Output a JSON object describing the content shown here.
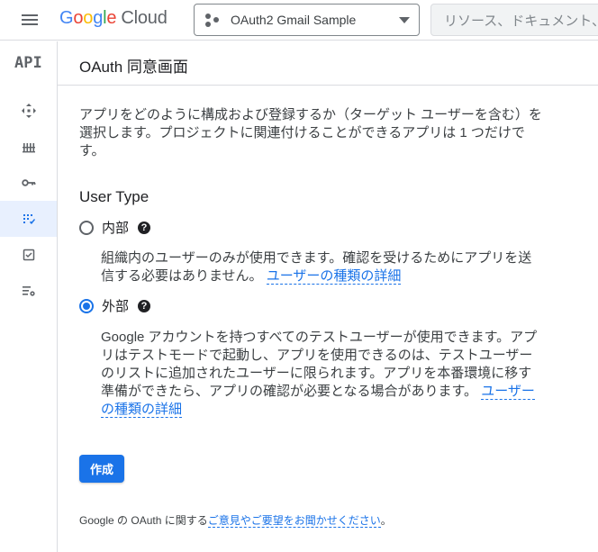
{
  "header": {
    "menu_icon": "hamburger-menu-icon",
    "logo": {
      "G": "G",
      "o1": "o",
      "o2": "o",
      "g": "g",
      "l": "l",
      "e": "e",
      "cloud": "Cloud"
    },
    "project_name": "OAuth2 Gmail Sample",
    "search_placeholder": "リソース、ドキュメント、"
  },
  "sidebar": {
    "api_label": "API",
    "items": [
      {
        "icon": "dashboard-icon",
        "active": false
      },
      {
        "icon": "library-icon",
        "active": false
      },
      {
        "icon": "key-icon",
        "active": false
      },
      {
        "icon": "consent-screen-icon",
        "active": true
      },
      {
        "icon": "checkbox-icon",
        "active": false
      },
      {
        "icon": "settings-list-icon",
        "active": false
      }
    ]
  },
  "main": {
    "title": "OAuth 同意画面",
    "intro": "アプリをどのように構成および登録するか（ターゲット ユーザーを含む）を選択します。プロジェクトに関連付けることができるアプリは 1 つだけです。",
    "user_type_title": "User Type",
    "internal": {
      "label": "内部",
      "checked": false,
      "desc": "組織内のユーザーのみが使用できます。確認を受けるためにアプリを送信する必要はありません。",
      "link": "ユーザーの種類の詳細"
    },
    "external": {
      "label": "外部",
      "checked": true,
      "desc": "Google アカウントを持つすべてのテストユーザーが使用できます。アプリはテストモードで起動し、アプリを使用できるのは、テストユーザーのリストに追加されたユーザーに限られます。アプリを本番環境に移す準備ができたら、アプリの確認が必要となる場合があります。",
      "link": "ユーザーの種類の詳細"
    },
    "help_glyph": "?",
    "create_button": "作成",
    "feedback_prefix": "Google の OAuth に関する",
    "feedback_link": "ご意見やご要望をお聞かせください",
    "feedback_suffix": "。"
  },
  "colors": {
    "accent": "#1a73e8",
    "active_bg": "#e8f0fe",
    "border": "#dadce0"
  }
}
